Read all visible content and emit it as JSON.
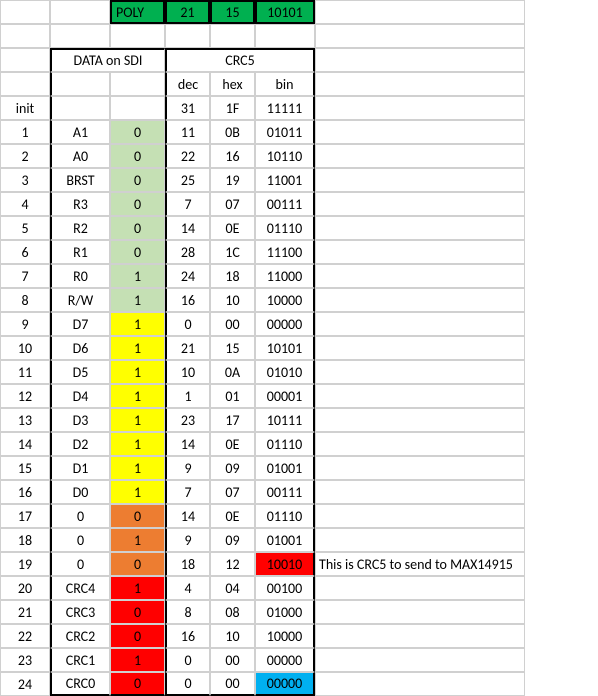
{
  "poly": {
    "label": "POLY",
    "dec": "21",
    "hex": "15",
    "bin": "10101"
  },
  "headers": {
    "data_on_sdi": "DATA on SDI",
    "crc5": "CRC5",
    "dec": "dec",
    "hex": "hex",
    "bin": "bin",
    "init": "init"
  },
  "init_row": {
    "dec": "31",
    "hex": "1F",
    "bin": "11111"
  },
  "rows": [
    {
      "n": "1",
      "lbl": "A1",
      "bit": "0",
      "bc": "lg",
      "dec": "11",
      "hex": "0B",
      "bin": "01011",
      "binc": ""
    },
    {
      "n": "2",
      "lbl": "A0",
      "bit": "0",
      "bc": "lg",
      "dec": "22",
      "hex": "16",
      "bin": "10110",
      "binc": ""
    },
    {
      "n": "3",
      "lbl": "BRST",
      "bit": "0",
      "bc": "lg",
      "dec": "25",
      "hex": "19",
      "bin": "11001",
      "binc": ""
    },
    {
      "n": "4",
      "lbl": "R3",
      "bit": "0",
      "bc": "lg",
      "dec": "7",
      "hex": "07",
      "bin": "00111",
      "binc": ""
    },
    {
      "n": "5",
      "lbl": "R2",
      "bit": "0",
      "bc": "lg",
      "dec": "14",
      "hex": "0E",
      "bin": "01110",
      "binc": ""
    },
    {
      "n": "6",
      "lbl": "R1",
      "bit": "0",
      "bc": "lg",
      "dec": "28",
      "hex": "1C",
      "bin": "11100",
      "binc": ""
    },
    {
      "n": "7",
      "lbl": "R0",
      "bit": "1",
      "bc": "lg",
      "dec": "24",
      "hex": "18",
      "bin": "11000",
      "binc": ""
    },
    {
      "n": "8",
      "lbl": "R/W",
      "bit": "1",
      "bc": "lg",
      "dec": "16",
      "hex": "10",
      "bin": "10000",
      "binc": ""
    },
    {
      "n": "9",
      "lbl": "D7",
      "bit": "1",
      "bc": "yl",
      "dec": "0",
      "hex": "00",
      "bin": "00000",
      "binc": ""
    },
    {
      "n": "10",
      "lbl": "D6",
      "bit": "1",
      "bc": "yl",
      "dec": "21",
      "hex": "15",
      "bin": "10101",
      "binc": ""
    },
    {
      "n": "11",
      "lbl": "D5",
      "bit": "1",
      "bc": "yl",
      "dec": "10",
      "hex": "0A",
      "bin": "01010",
      "binc": ""
    },
    {
      "n": "12",
      "lbl": "D4",
      "bit": "1",
      "bc": "yl",
      "dec": "1",
      "hex": "01",
      "bin": "00001",
      "binc": ""
    },
    {
      "n": "13",
      "lbl": "D3",
      "bit": "1",
      "bc": "yl",
      "dec": "23",
      "hex": "17",
      "bin": "10111",
      "binc": ""
    },
    {
      "n": "14",
      "lbl": "D2",
      "bit": "1",
      "bc": "yl",
      "dec": "14",
      "hex": "0E",
      "bin": "01110",
      "binc": ""
    },
    {
      "n": "15",
      "lbl": "D1",
      "bit": "1",
      "bc": "yl",
      "dec": "9",
      "hex": "09",
      "bin": "01001",
      "binc": ""
    },
    {
      "n": "16",
      "lbl": "D0",
      "bit": "1",
      "bc": "yl",
      "dec": "7",
      "hex": "07",
      "bin": "00111",
      "binc": ""
    },
    {
      "n": "17",
      "lbl": "0",
      "bit": "0",
      "bc": "or",
      "dec": "14",
      "hex": "0E",
      "bin": "01110",
      "binc": ""
    },
    {
      "n": "18",
      "lbl": "0",
      "bit": "1",
      "bc": "or",
      "dec": "9",
      "hex": "09",
      "bin": "01001",
      "binc": ""
    },
    {
      "n": "19",
      "lbl": "0",
      "bit": "0",
      "bc": "or",
      "dec": "18",
      "hex": "12",
      "bin": "10010",
      "binc": "rd",
      "note": "This is CRC5 to send to MAX14915"
    },
    {
      "n": "20",
      "lbl": "CRC4",
      "bit": "1",
      "bc": "rd",
      "dec": "4",
      "hex": "04",
      "bin": "00100",
      "binc": ""
    },
    {
      "n": "21",
      "lbl": "CRC3",
      "bit": "0",
      "bc": "rd",
      "dec": "8",
      "hex": "08",
      "bin": "01000",
      "binc": ""
    },
    {
      "n": "22",
      "lbl": "CRC2",
      "bit": "0",
      "bc": "rd",
      "dec": "16",
      "hex": "10",
      "bin": "10000",
      "binc": ""
    },
    {
      "n": "23",
      "lbl": "CRC1",
      "bit": "1",
      "bc": "rd",
      "dec": "0",
      "hex": "00",
      "bin": "00000",
      "binc": ""
    },
    {
      "n": "24",
      "lbl": "CRC0",
      "bit": "0",
      "bc": "rd",
      "dec": "0",
      "hex": "00",
      "bin": "00000",
      "binc": "cy"
    }
  ]
}
